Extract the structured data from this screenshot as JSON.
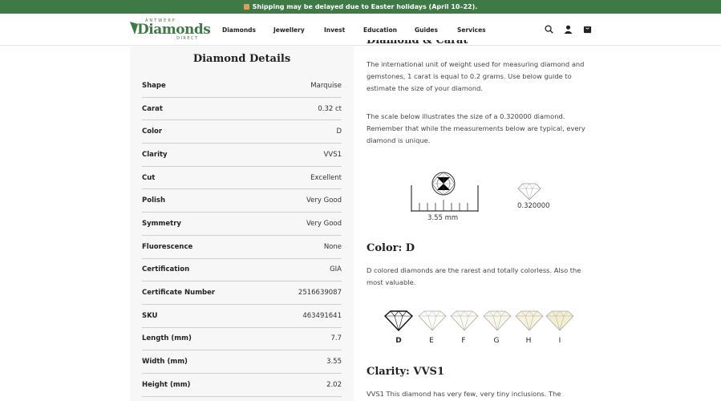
{
  "announcement": {
    "text": "Shipping may be delayed due to Easter holidays (April 10–22)."
  },
  "logo": {
    "top": "ANTWERP",
    "main": "Diamonds",
    "sub": ".DIRECT"
  },
  "nav": [
    "Diamonds",
    "Jewellery",
    "Invest",
    "Education",
    "Guides",
    "Services"
  ],
  "header_icons": [
    "search-icon",
    "account-icon",
    "cart-icon"
  ],
  "details": {
    "title": "Diamond Details",
    "rows": [
      {
        "k": "Shape",
        "v": "Marquise"
      },
      {
        "k": "Carat",
        "v": "0.32 ct"
      },
      {
        "k": "Color",
        "v": "D"
      },
      {
        "k": "Clarity",
        "v": "VVS1"
      },
      {
        "k": "Cut",
        "v": "Excellent"
      },
      {
        "k": "Polish",
        "v": "Very Good"
      },
      {
        "k": "Symmetry",
        "v": "Very Good"
      },
      {
        "k": "Fluorescence",
        "v": "None"
      },
      {
        "k": "Certification",
        "v": "GIA"
      },
      {
        "k": "Certificate Number",
        "v": "2516639087"
      },
      {
        "k": "SKU",
        "v": "463491641"
      },
      {
        "k": "Length (mm)",
        "v": "7.7"
      },
      {
        "k": "Width (mm)",
        "v": "3.55"
      },
      {
        "k": "Height (mm)",
        "v": "2.02"
      }
    ]
  },
  "carat": {
    "heading": "Diamond & Carat",
    "p1": "The international unit of weight used for measuring diamond and gemstones, 1 carat is equal to 0.2 grams. Use below guide to estimate the size of your diamond.",
    "p2": "The scale below illustrates the size of a 0.320000 diamond. Remember that while the measurements below are typical, every diamond is unique.",
    "scale_label": "3.55 mm",
    "diamond_label": "0.320000"
  },
  "color": {
    "heading": "Color: D",
    "p": "D colored diamonds are the rarest and totally colorless. Also the most valuable.",
    "grades": [
      "D",
      "E",
      "F",
      "G",
      "H",
      "I"
    ],
    "selected": "D"
  },
  "clarity": {
    "heading": "Clarity: VVS1",
    "p": "VVS1 This diamond has very few, very tiny inclusions. The"
  }
}
